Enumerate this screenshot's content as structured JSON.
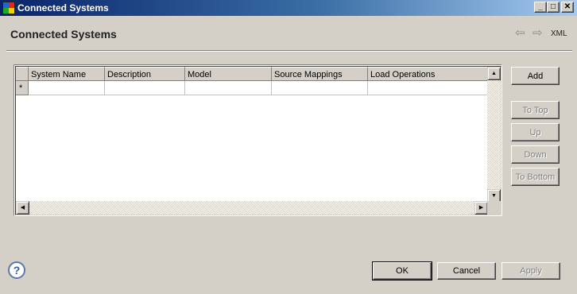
{
  "window": {
    "title": "Connected Systems",
    "minimize_glyph": "_",
    "maximize_glyph": "□",
    "close_glyph": "✕"
  },
  "header": {
    "title": "Connected Systems",
    "back_icon": "⇦",
    "forward_icon": "⇨",
    "xml_label": "XML"
  },
  "table": {
    "columns": [
      "System Name",
      "Description",
      "Model",
      "Source Mappings",
      "Load Operations"
    ],
    "new_row_marker": "*"
  },
  "side_buttons": {
    "add": "Add",
    "to_top": "To Top",
    "up": "Up",
    "down": "Down",
    "to_bottom": "To Bottom"
  },
  "footer": {
    "help_glyph": "?",
    "ok": "OK",
    "cancel": "Cancel",
    "apply": "Apply"
  },
  "scroll_glyphs": {
    "up": "▲",
    "down": "▼",
    "left": "◀",
    "right": "▶"
  }
}
